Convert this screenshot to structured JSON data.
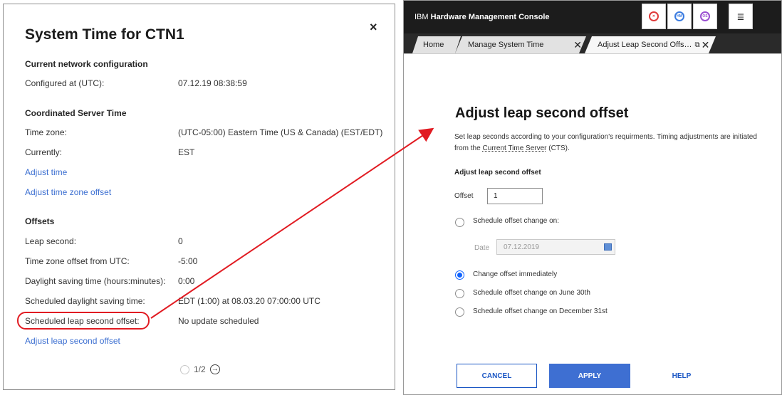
{
  "left": {
    "title": "System Time for CTN1",
    "close": "×",
    "sections": {
      "network": "Current network configuration",
      "cst": "Coordinated Server Time",
      "offsets": "Offsets"
    },
    "rows": {
      "configured_label": "Configured at (UTC):",
      "configured_value": "07.12.19 08:38:59",
      "timezone_label": "Time zone:",
      "timezone_value": "(UTC-05:00) Eastern Time (US & Canada) (EST/EDT)",
      "currently_label": "Currently:",
      "currently_value": "EST",
      "leap_label": "Leap second:",
      "leap_value": "0",
      "tzoffset_label": "Time zone offset from UTC:",
      "tzoffset_value": "-5:00",
      "dst_label": "Daylight saving time (hours:minutes):",
      "dst_value": "0:00",
      "sched_dst_label": "Scheduled daylight saving time:",
      "sched_dst_value": "EDT (1:00) at 08.03.20 07:00:00 UTC",
      "sched_leap_label": "Scheduled leap second offset:",
      "sched_leap_value": "No update scheduled"
    },
    "links": {
      "adjust_time": "Adjust time",
      "adjust_tz": "Adjust time zone offset",
      "adjust_leap": "Adjust leap second offset"
    },
    "pager": "1/2"
  },
  "right": {
    "app_prefix": "IBM",
    "app_name": "Hardware Management Console",
    "icons": [
      "error-icon",
      "hmc-icon",
      "os-icon",
      "menu-icon"
    ],
    "tabs": {
      "home": "Home",
      "manage": "Manage System Time",
      "adjust": "Adjust Leap Second Offs…"
    },
    "heading": "Adjust leap second offset",
    "description_pre": "Set leap seconds according to your configuration's requirments. Timing adjustments are initiated from the ",
    "description_link": "Current Time Server",
    "description_post": " (CTS).",
    "subheading": "Adjust leap second offset",
    "offset_label": "Offset",
    "offset_value": "1",
    "radio_schedule_on": "Schedule offset change on:",
    "date_label": "Date",
    "date_value": "07.12.2019",
    "radio_immediately": "Change offset immediately",
    "radio_june": "Schedule offset change on June 30th",
    "radio_december": "Schedule offset change on December 31st",
    "cancel": "CANCEL",
    "apply": "APPLY",
    "help": "HELP"
  },
  "colors": {
    "annotation": "#e11b22",
    "link": "#3c6fd1",
    "primary": "#3e6fd2",
    "topbar": "#1c1c1c"
  }
}
